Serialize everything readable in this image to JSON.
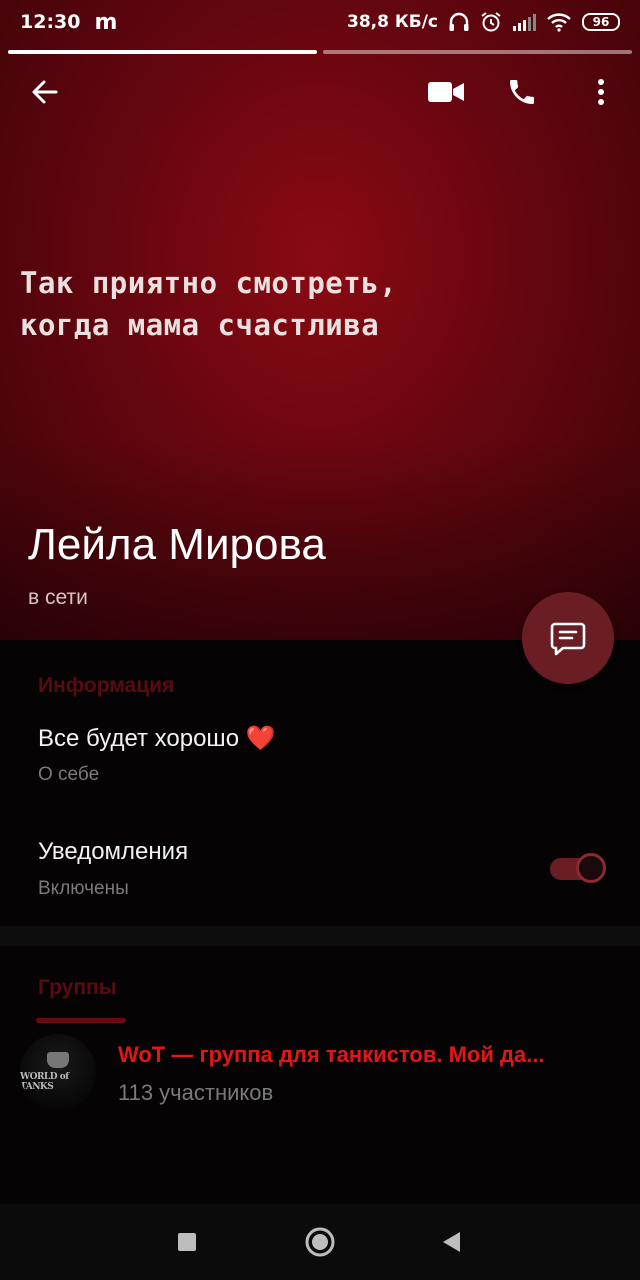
{
  "status_bar": {
    "time": "12:30",
    "carrier_icon": "m",
    "net_speed": "38,8 КБ/с",
    "battery": "96",
    "icons": [
      "headphones-icon",
      "alarm-icon",
      "signal-icon",
      "wifi-icon",
      "battery-icon"
    ]
  },
  "story_progress": {
    "segments": 2,
    "active_index": 0
  },
  "toolbar": {
    "back_icon": "arrow-left-icon",
    "actions": [
      "video-call-icon",
      "phone-icon",
      "more-vert-icon"
    ]
  },
  "cover": {
    "quote_line1": "Так приятно смотреть,",
    "quote_line2": "когда мама счастлива",
    "background_color": "#6a0610"
  },
  "profile": {
    "name": "Лейла Мирова",
    "presence": "в сети"
  },
  "fab": {
    "icon": "message-icon",
    "color": "#6a1e24"
  },
  "info": {
    "section_title": "Информация",
    "about_value": "Все будет хорошо ❤️",
    "about_label": "О себе",
    "notifications_title": "Уведомления",
    "notifications_value": "Включены",
    "notifications_enabled": true,
    "accent_color": "#5a0b12"
  },
  "groups": {
    "section_title": "Группы",
    "items": [
      {
        "name": "WoT — группа для танкистов. Мой да...",
        "members": "113 участников",
        "avatar_text": "WORLD of TANKS"
      }
    ],
    "name_color": "#e11717"
  },
  "nav_bar": {
    "icons": [
      "recents-square-icon",
      "home-circle-icon",
      "back-triangle-icon"
    ]
  }
}
